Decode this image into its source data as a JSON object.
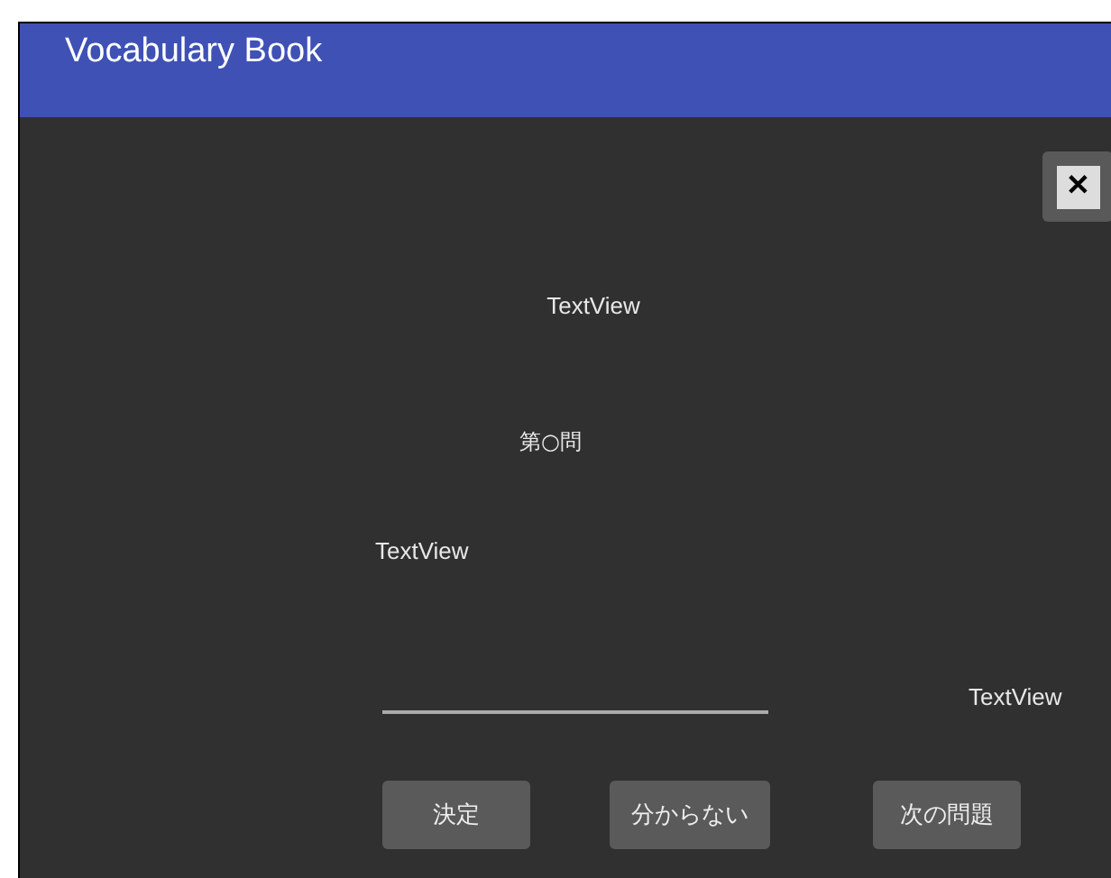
{
  "app_bar": {
    "title": "Vocabulary Book"
  },
  "close_button": {
    "label": "✕"
  },
  "word_text": "TextView",
  "question_number": "第○問",
  "hint_text": "TextView",
  "result_text": "TextView",
  "buttons": [
    {
      "label": "決定"
    },
    {
      "label": "分からない"
    },
    {
      "label": "次の問題"
    }
  ]
}
